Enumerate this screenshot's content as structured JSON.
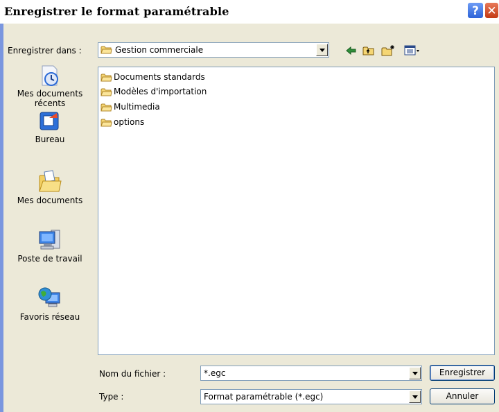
{
  "window": {
    "title": "Enregistrer le format paramétrable",
    "help_glyph": "?",
    "close_glyph": "✕"
  },
  "toolbar": {
    "save_in_label": "Enregistrer dans :",
    "location": "Gestion commerciale",
    "icons": [
      "back-arrow-icon",
      "up-folder-icon",
      "new-folder-icon",
      "view-menu-icon"
    ]
  },
  "places": [
    {
      "icon": "recent-documents-icon",
      "label": "Mes documents récents"
    },
    {
      "icon": "desktop-icon",
      "label": "Bureau"
    },
    {
      "icon": "my-documents-icon",
      "label": "Mes documents"
    },
    {
      "icon": "my-computer-icon",
      "label": "Poste de travail"
    },
    {
      "icon": "network-places-icon",
      "label": "Favoris réseau"
    }
  ],
  "files": [
    {
      "name": "Documents standards",
      "icon": "folder-icon"
    },
    {
      "name": "Modèles d'importation",
      "icon": "folder-icon"
    },
    {
      "name": "Multimedia",
      "icon": "folder-icon"
    },
    {
      "name": "options",
      "icon": "folder-icon"
    }
  ],
  "filename": {
    "label": "Nom du fichier :",
    "value": "*.egc"
  },
  "filetype": {
    "label": "Type :",
    "value": "Format paramétrable (*.egc)"
  },
  "buttons": {
    "save": "Enregistrer",
    "cancel": "Annuler"
  },
  "colors": {
    "dialog_bg": "#ece9d8",
    "folder": "#f5d674",
    "accent": "#2d63d8"
  }
}
